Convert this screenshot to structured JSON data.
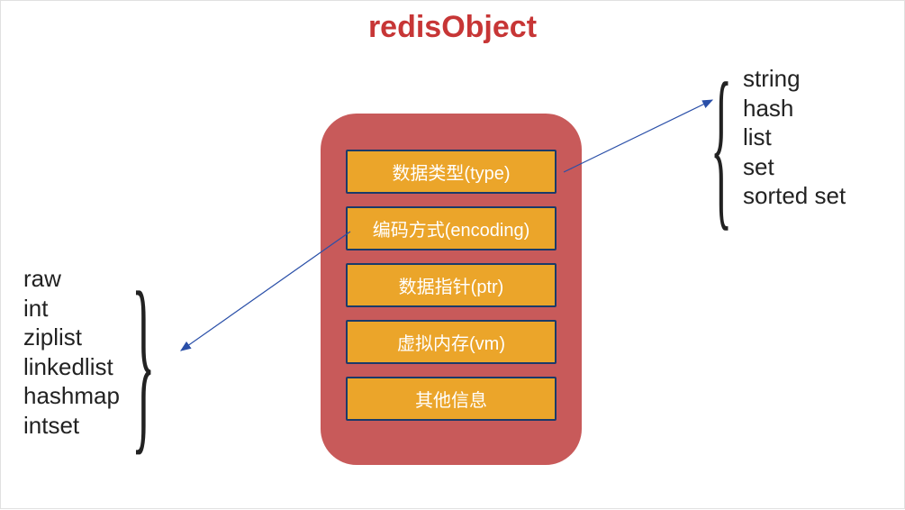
{
  "title": "redisObject",
  "fields": [
    "数据类型(type)",
    "编码方式(encoding)",
    "数据指针(ptr)",
    "虚拟内存(vm)",
    "其他信息"
  ],
  "encodingList": [
    "raw",
    "int",
    "ziplist",
    "linkedlist",
    "hashmap",
    "intset"
  ],
  "typeList": [
    "string",
    "hash",
    "list",
    "set",
    "sorted set"
  ]
}
